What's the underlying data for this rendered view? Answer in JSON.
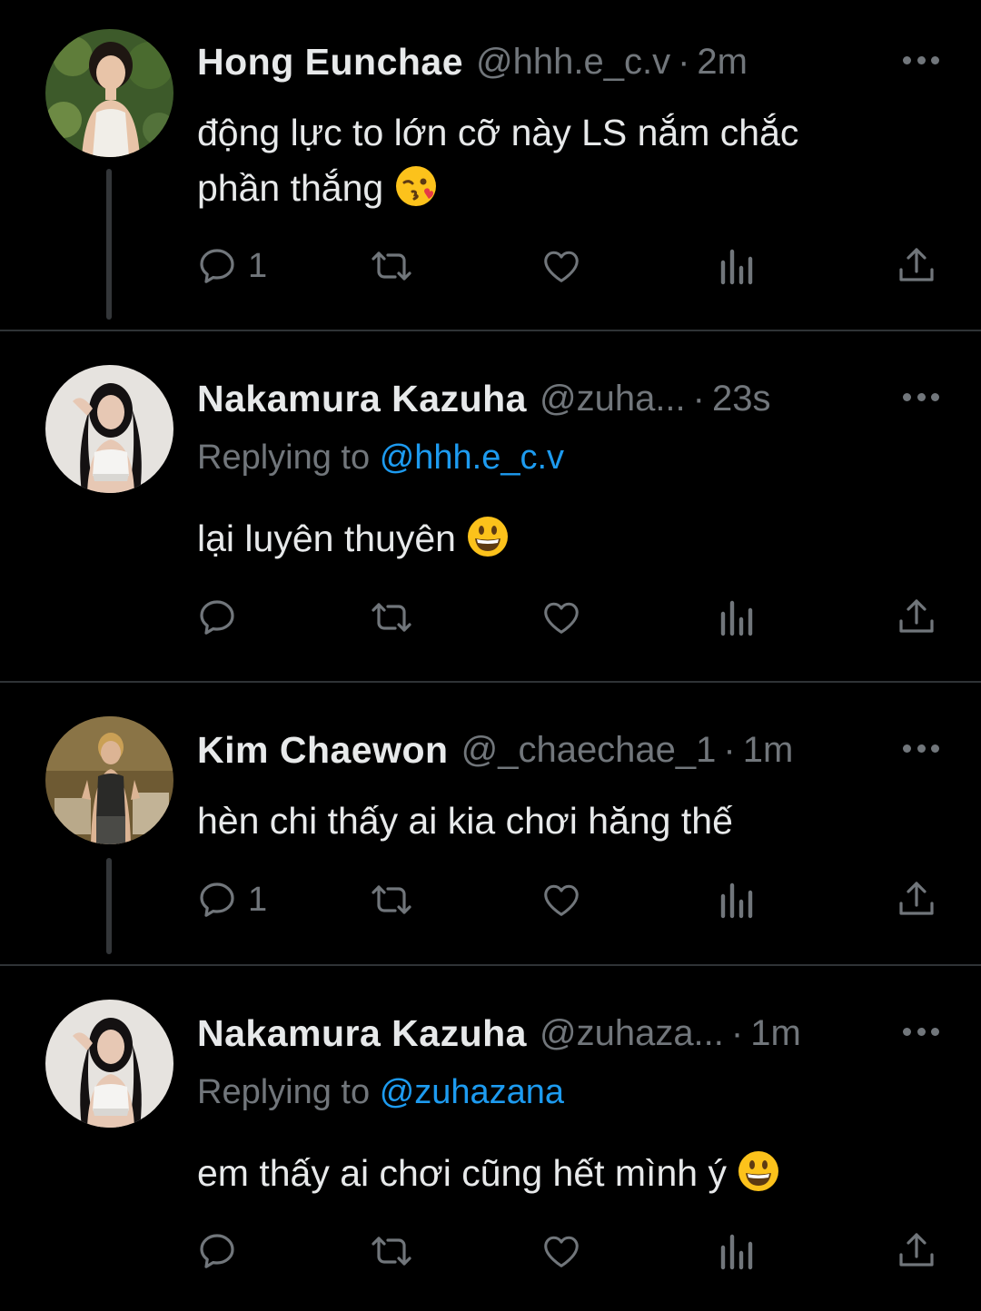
{
  "tweets": [
    {
      "name": "Hong Eunchae",
      "handle": "@hhh.e_c.v",
      "dot": "·",
      "time": "2m",
      "text_lines": [
        "động lực to lớn cỡ này LS nắm chắc",
        "phần thắng"
      ],
      "emoji": "face-blowing-kiss-emoji",
      "reply_count": "1",
      "avatar_colors": {
        "bg": "#3d5a2a",
        "skin": "#e8c4a8",
        "hair": "#1e1612",
        "top": "#f1eee8"
      }
    },
    {
      "name": "Nakamura Kazuha",
      "handle": "@zuha...",
      "dot": "·",
      "time": "23s",
      "replying_prefix": "Replying to",
      "replying_to": "@hhh.e_c.v",
      "text": "lại luyên thuyên",
      "emoji": "grinning-face-emoji",
      "reply_count": "",
      "avatar_colors": {
        "bg": "#e6e3df",
        "skin": "#e7c8b4",
        "hair": "#141112",
        "top": "#f5f4f2"
      }
    },
    {
      "name": "Kim Chaewon",
      "handle": "@_chaechae_1",
      "dot": "·",
      "time": "1m",
      "text": "hèn chi thấy ai kia chơi hăng thế",
      "reply_count": "1",
      "avatar_colors": {
        "bg": "#6e5a33",
        "skin": "#dcb494",
        "hair": "#caa055",
        "top": "#2a2a28"
      }
    },
    {
      "name": "Nakamura Kazuha",
      "handle": "@zuhaza...",
      "dot": "·",
      "time": "1m",
      "replying_prefix": "Replying to",
      "replying_to": "@zuhazana",
      "text": "em thấy ai chơi cũng hết mình ý",
      "emoji": "grinning-face-emoji",
      "reply_count": "",
      "avatar_colors": {
        "bg": "#e6e3df",
        "skin": "#e7c8b4",
        "hair": "#141112",
        "top": "#f5f4f2"
      }
    }
  ],
  "colors": {
    "background": "#000000",
    "text": "#e7e9ea",
    "secondary": "#71767b",
    "link": "#1d9bf0",
    "divider": "#2f3336"
  }
}
